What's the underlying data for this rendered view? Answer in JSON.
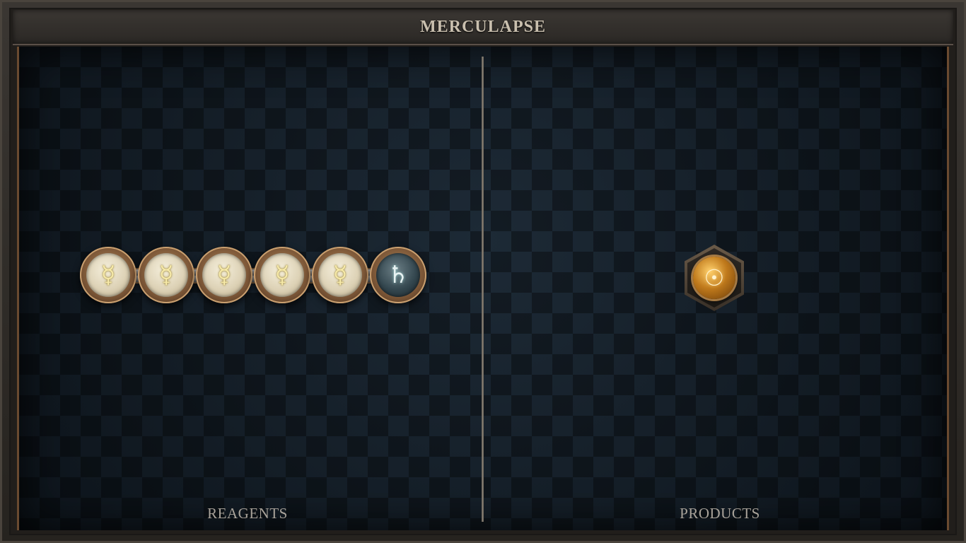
{
  "title": "MERCULAPSE",
  "reagents": {
    "label": "REAGENTS",
    "atoms": [
      {
        "type": "mercury",
        "symbol": "☿"
      },
      {
        "type": "mercury",
        "symbol": "☿"
      },
      {
        "type": "mercury",
        "symbol": "☿"
      },
      {
        "type": "mercury",
        "symbol": "☿"
      },
      {
        "type": "mercury",
        "symbol": "☿"
      },
      {
        "type": "lead",
        "symbol": "♄"
      }
    ]
  },
  "products": {
    "label": "PRODUCTS",
    "atoms": [
      {
        "type": "gold",
        "symbol": "☉"
      }
    ]
  },
  "colors": {
    "board": "#141d26",
    "frame": "#2a2723",
    "accent_copper": "#6a4a30",
    "label_text": "#a9a39a"
  }
}
